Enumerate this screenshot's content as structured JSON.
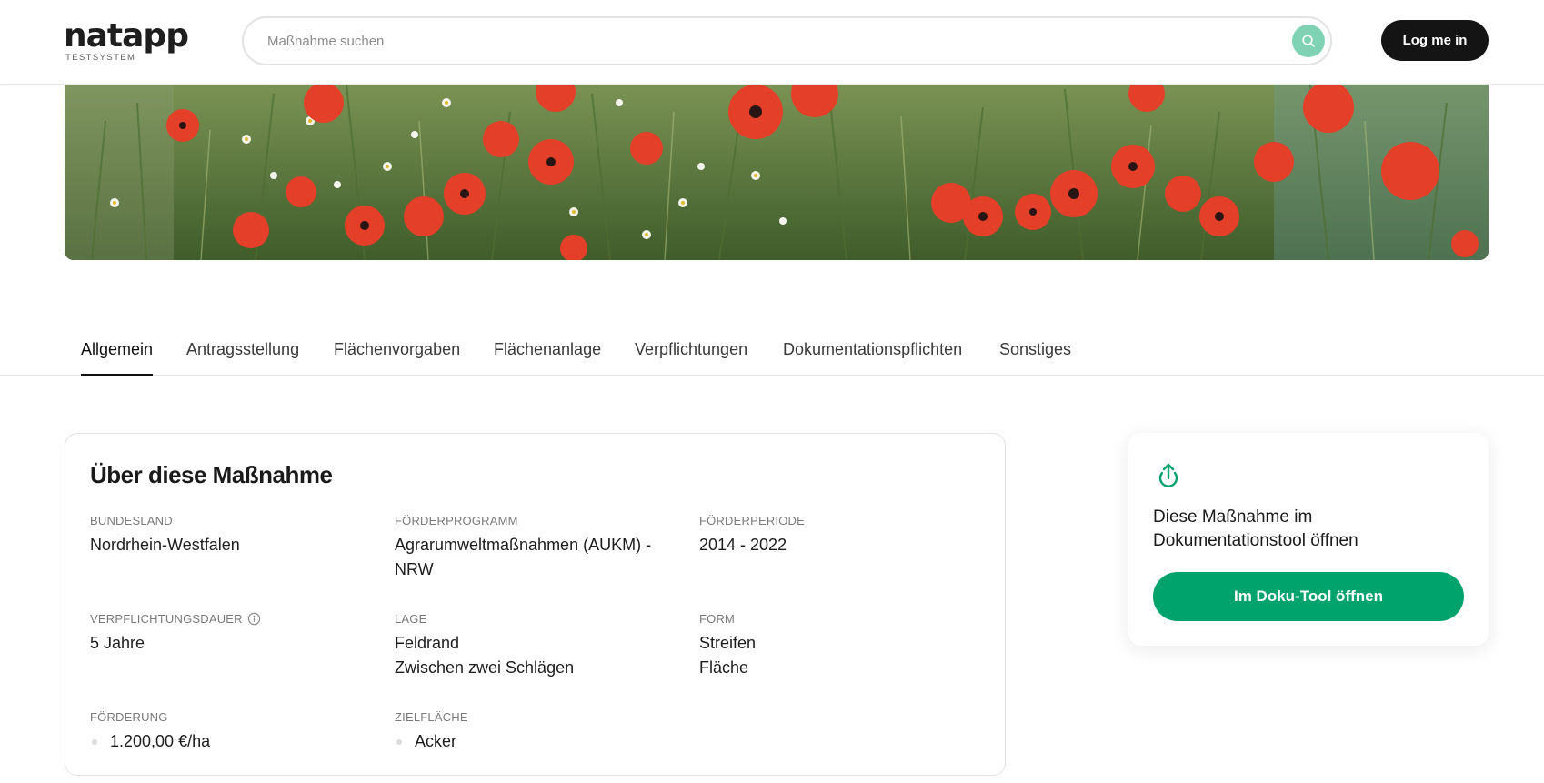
{
  "header": {
    "logo_text": "natapp",
    "logo_subtitle": "TESTSYSTEM",
    "search_placeholder": "Maßnahme suchen",
    "login_label": "Log me in"
  },
  "tabs": [
    {
      "label": "Allgemein",
      "active": true
    },
    {
      "label": "Antragsstellung",
      "active": false
    },
    {
      "label": "Flächenvorgaben",
      "active": false
    },
    {
      "label": "Flächenanlage",
      "active": false
    },
    {
      "label": "Verpflichtungen",
      "active": false
    },
    {
      "label": "Dokumentationspflichten",
      "active": false
    },
    {
      "label": "Sonstiges",
      "active": false
    }
  ],
  "info": {
    "title": "Über diese Maßnahme",
    "bundesland": {
      "label": "BUNDESLAND",
      "value": "Nordrhein-Westfalen"
    },
    "foerderprogramm": {
      "label": "FÖRDERPROGRAMM",
      "value_line1": "Agrarumweltmaßnahmen (AUKM) -",
      "value_line2": "NRW"
    },
    "foerderperiode": {
      "label": "FÖRDERPERIODE",
      "value": "2014 - 2022"
    },
    "verpflichtungsdauer": {
      "label": "VERPFLICHTUNGSDAUER",
      "value": "5 Jahre"
    },
    "lage": {
      "label": "LAGE",
      "values": [
        "Feldrand",
        "Zwischen zwei Schlägen"
      ]
    },
    "form": {
      "label": "FORM",
      "values": [
        "Streifen",
        "Fläche"
      ]
    },
    "foerderung": {
      "label": "FÖRDERUNG",
      "values": [
        "1.200,00 €/ha"
      ]
    },
    "zielflaeche": {
      "label": "ZIELFLÄCHE",
      "values": [
        "Acker"
      ]
    }
  },
  "side": {
    "icon": "upload-icon",
    "text": "Diese Maßnahme im Dokumentationstool öffnen",
    "button_label": "Im Doku-Tool öffnen"
  },
  "colors": {
    "accent_green": "#00a36c",
    "search_button": "#7fd3b4",
    "login_button": "#141414"
  }
}
